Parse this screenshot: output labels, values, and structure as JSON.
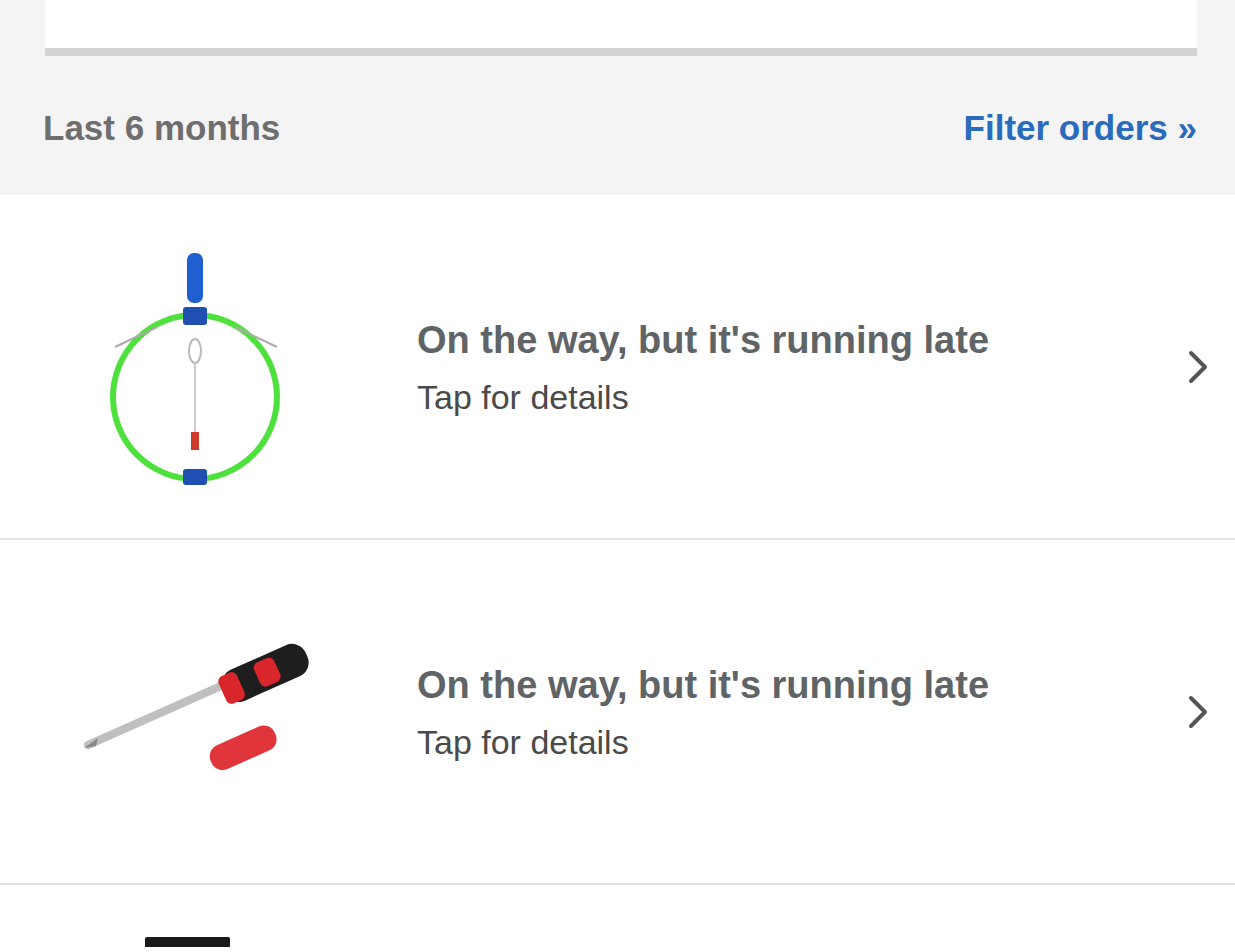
{
  "header": {
    "range": "Last 6 months",
    "filter_link": "Filter orders »"
  },
  "orders": [
    {
      "status": "On the way, but it's running late",
      "detail": "Tap for details"
    },
    {
      "status": "On the way, but it's running late",
      "detail": "Tap for details"
    }
  ]
}
